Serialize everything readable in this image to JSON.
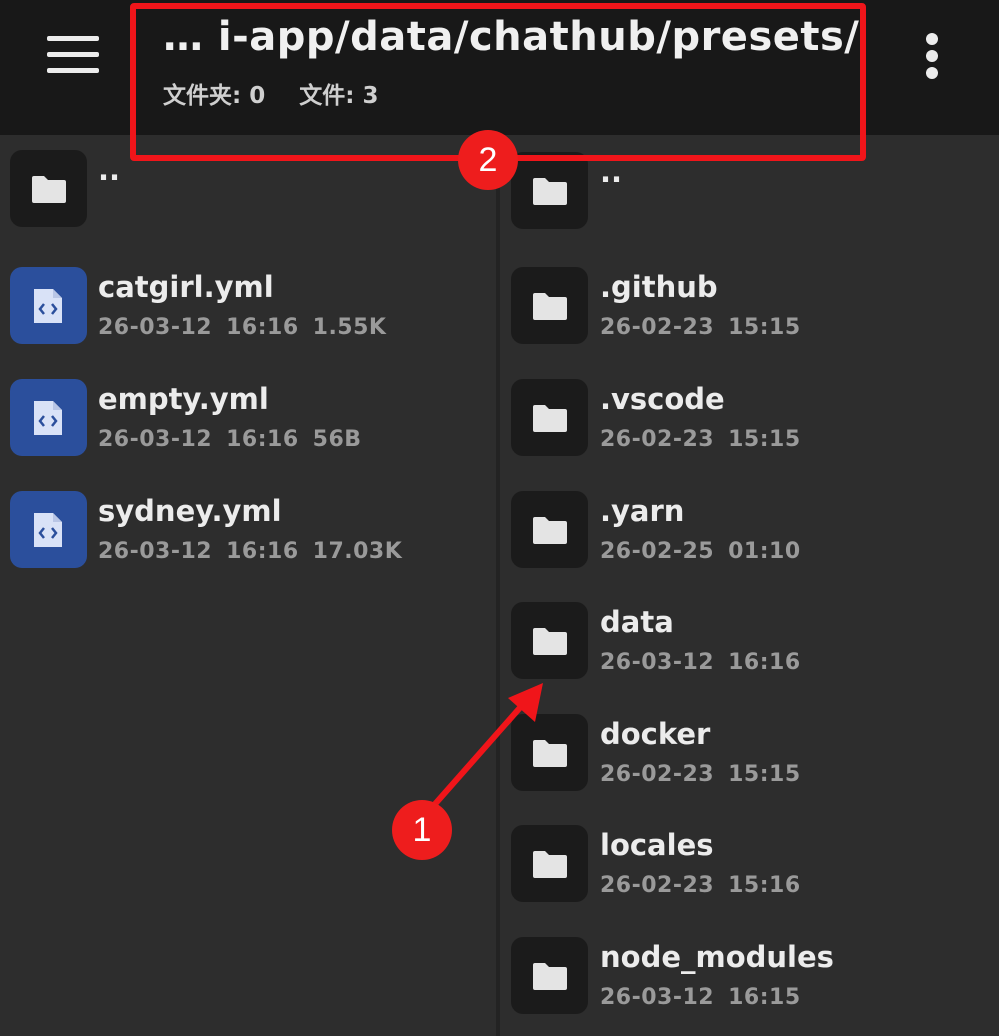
{
  "header": {
    "path_title": "… i-app/data/chathub/presets/",
    "folder_count_label": "文件夹: 0",
    "file_count_label": "文件: 3"
  },
  "annotations": {
    "badge_1": "1",
    "badge_2": "2",
    "color": "#f0151a"
  },
  "left_pane": {
    "parent": {
      "name": "..",
      "icon": "folder-icon"
    },
    "items": [
      {
        "name": "catgirl.yml",
        "date": "26-03-12",
        "time": "16:16",
        "size": "1.55K",
        "icon": "code-file-icon"
      },
      {
        "name": "empty.yml",
        "date": "26-03-12",
        "time": "16:16",
        "size": "56B",
        "icon": "code-file-icon"
      },
      {
        "name": "sydney.yml",
        "date": "26-03-12",
        "time": "16:16",
        "size": "17.03K",
        "icon": "code-file-icon"
      }
    ]
  },
  "right_pane": {
    "parent": {
      "name": "..",
      "icon": "folder-icon"
    },
    "items": [
      {
        "name": ".github",
        "date": "26-02-23",
        "time": "15:15",
        "icon": "folder-icon"
      },
      {
        "name": ".vscode",
        "date": "26-02-23",
        "time": "15:15",
        "icon": "folder-icon"
      },
      {
        "name": ".yarn",
        "date": "26-02-25",
        "time": "01:10",
        "icon": "folder-icon"
      },
      {
        "name": "data",
        "date": "26-03-12",
        "time": "16:16",
        "icon": "folder-icon"
      },
      {
        "name": "docker",
        "date": "26-02-23",
        "time": "15:15",
        "icon": "folder-icon"
      },
      {
        "name": "locales",
        "date": "26-02-23",
        "time": "15:16",
        "icon": "folder-icon"
      },
      {
        "name": "node_modules",
        "date": "26-03-12",
        "time": "16:15",
        "icon": "folder-icon"
      }
    ]
  },
  "colors": {
    "header_bg": "#181818",
    "pane_bg": "#2d2d2d",
    "file_icon_bg": "#2b4f9c",
    "folder_icon_bg": "#1b1b1b",
    "annotation_red": "#f0151a"
  }
}
